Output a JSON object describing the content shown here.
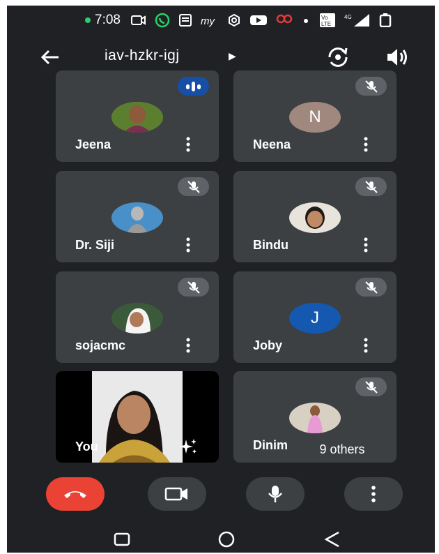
{
  "status_bar": {
    "time": "7:08",
    "icons": [
      "screen-record-icon",
      "whatsapp-icon",
      "news-icon",
      "myjio-icon",
      "settings-icon",
      "youtube-icon",
      "hood-icon",
      "dot-icon",
      "volte-icon",
      "signal-4g-icon",
      "battery-icon"
    ],
    "network_label": "4G"
  },
  "header": {
    "meeting_code": "iav-hzkr-igj"
  },
  "participants": [
    {
      "name": "Jeena",
      "state": "speaking"
    },
    {
      "name": "Neena",
      "initial": "N",
      "color": "#a1887f",
      "state": "muted"
    },
    {
      "name": "Dr. Siji",
      "state": "muted"
    },
    {
      "name": "Bindu",
      "state": "muted"
    },
    {
      "name": "sojacmc",
      "state": "muted"
    },
    {
      "name": "Joby",
      "initial": "J",
      "color": "#1558b0",
      "state": "muted"
    },
    {
      "name": "You",
      "state": "self"
    },
    {
      "name": "Dinim",
      "state": "muted"
    }
  ],
  "others_label": "9 others",
  "colors": {
    "background": "#202124",
    "tile": "#3c4043",
    "hangup": "#ea4335",
    "speaking_badge": "#174ea6"
  }
}
